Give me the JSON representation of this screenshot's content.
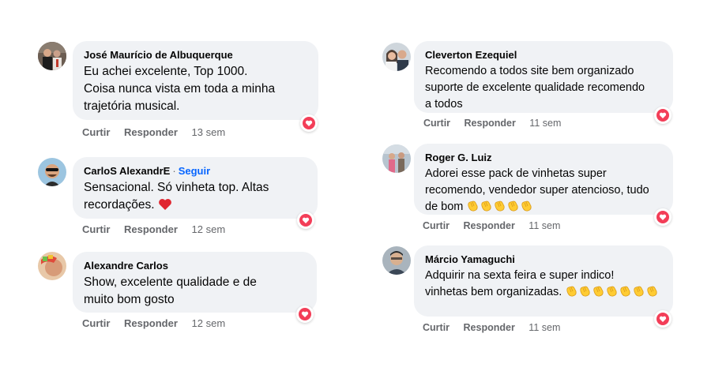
{
  "colors": {
    "bubble": "#f0f2f5",
    "reaction_heart": "#f33e58",
    "follow_link": "#0866ff",
    "meta_text": "#65676b",
    "clap": "#ffcc33"
  },
  "comments": [
    {
      "name": "José Maurício de Albuquerque",
      "lines": [
        "Eu achei excelente, Top 1000.",
        "Coisa nunca vista em toda a minha",
        "trajetória musical."
      ],
      "like_label": "Curtir",
      "reply_label": "Responder",
      "time": "13 sem",
      "reaction": "heart-icon"
    },
    {
      "name": "CarloS AlexandrE",
      "follow_label": "Seguir",
      "lines": [
        "Sensacional. Só vinheta top. Altas",
        "recordações."
      ],
      "trailing_emoji": "red-heart-icon",
      "like_label": "Curtir",
      "reply_label": "Responder",
      "time": "12 sem",
      "reaction": "heart-icon"
    },
    {
      "name": "Alexandre Carlos",
      "lines": [
        "Show, excelente qualidade e de",
        "muito bom gosto"
      ],
      "like_label": "Curtir",
      "reply_label": "Responder",
      "time": "12 sem",
      "reaction": "heart-icon"
    },
    {
      "name": "Cleverton Ezequiel",
      "lines": [
        "Recomendo a todos site bem organizado",
        "suporte de excelente qualidade recomendo",
        "a todos"
      ],
      "like_label": "Curtir",
      "reply_label": "Responder",
      "time": "11 sem",
      "reaction": "heart-icon"
    },
    {
      "name": "Roger G. Luiz",
      "lines": [
        "Adorei esse pack de vinhetas super",
        "recomendo, vendedor super atencioso, tudo",
        "de bom"
      ],
      "trailing_emoji": "clapping-hands-icon",
      "clap_count": 5,
      "like_label": "Curtir",
      "reply_label": "Responder",
      "time": "11 sem",
      "reaction": "heart-icon"
    },
    {
      "name": "Márcio Yamaguchi",
      "lines": [
        "Adquirir na sexta feira e super indico!",
        "vinhetas bem organizadas."
      ],
      "trailing_emoji": "clapping-hands-icon",
      "clap_count": 7,
      "like_label": "Curtir",
      "reply_label": "Responder",
      "time": "11 sem",
      "reaction": "heart-icon"
    }
  ]
}
